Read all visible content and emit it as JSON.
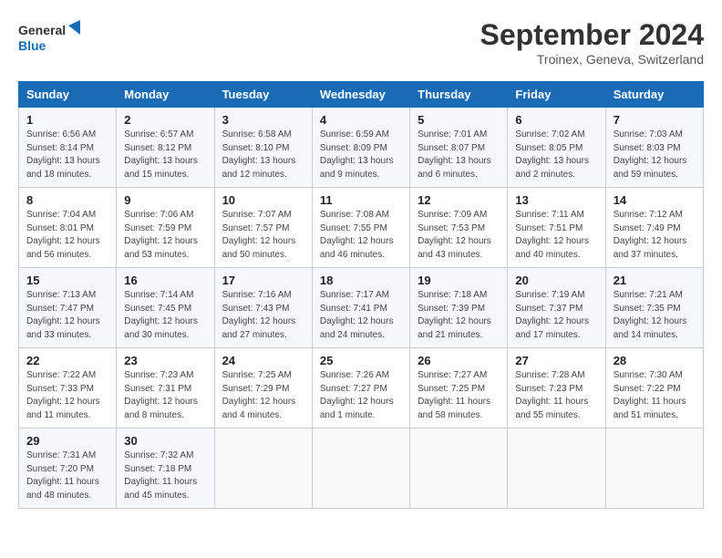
{
  "header": {
    "logo_line1": "General",
    "logo_line2": "Blue",
    "month_title": "September 2024",
    "location": "Troinex, Geneva, Switzerland"
  },
  "weekdays": [
    "Sunday",
    "Monday",
    "Tuesday",
    "Wednesday",
    "Thursday",
    "Friday",
    "Saturday"
  ],
  "weeks": [
    [
      {
        "day": "1",
        "info": "Sunrise: 6:56 AM\nSunset: 8:14 PM\nDaylight: 13 hours\nand 18 minutes."
      },
      {
        "day": "2",
        "info": "Sunrise: 6:57 AM\nSunset: 8:12 PM\nDaylight: 13 hours\nand 15 minutes."
      },
      {
        "day": "3",
        "info": "Sunrise: 6:58 AM\nSunset: 8:10 PM\nDaylight: 13 hours\nand 12 minutes."
      },
      {
        "day": "4",
        "info": "Sunrise: 6:59 AM\nSunset: 8:09 PM\nDaylight: 13 hours\nand 9 minutes."
      },
      {
        "day": "5",
        "info": "Sunrise: 7:01 AM\nSunset: 8:07 PM\nDaylight: 13 hours\nand 6 minutes."
      },
      {
        "day": "6",
        "info": "Sunrise: 7:02 AM\nSunset: 8:05 PM\nDaylight: 13 hours\nand 2 minutes."
      },
      {
        "day": "7",
        "info": "Sunrise: 7:03 AM\nSunset: 8:03 PM\nDaylight: 12 hours\nand 59 minutes."
      }
    ],
    [
      {
        "day": "8",
        "info": "Sunrise: 7:04 AM\nSunset: 8:01 PM\nDaylight: 12 hours\nand 56 minutes."
      },
      {
        "day": "9",
        "info": "Sunrise: 7:06 AM\nSunset: 7:59 PM\nDaylight: 12 hours\nand 53 minutes."
      },
      {
        "day": "10",
        "info": "Sunrise: 7:07 AM\nSunset: 7:57 PM\nDaylight: 12 hours\nand 50 minutes."
      },
      {
        "day": "11",
        "info": "Sunrise: 7:08 AM\nSunset: 7:55 PM\nDaylight: 12 hours\nand 46 minutes."
      },
      {
        "day": "12",
        "info": "Sunrise: 7:09 AM\nSunset: 7:53 PM\nDaylight: 12 hours\nand 43 minutes."
      },
      {
        "day": "13",
        "info": "Sunrise: 7:11 AM\nSunset: 7:51 PM\nDaylight: 12 hours\nand 40 minutes."
      },
      {
        "day": "14",
        "info": "Sunrise: 7:12 AM\nSunset: 7:49 PM\nDaylight: 12 hours\nand 37 minutes."
      }
    ],
    [
      {
        "day": "15",
        "info": "Sunrise: 7:13 AM\nSunset: 7:47 PM\nDaylight: 12 hours\nand 33 minutes."
      },
      {
        "day": "16",
        "info": "Sunrise: 7:14 AM\nSunset: 7:45 PM\nDaylight: 12 hours\nand 30 minutes."
      },
      {
        "day": "17",
        "info": "Sunrise: 7:16 AM\nSunset: 7:43 PM\nDaylight: 12 hours\nand 27 minutes."
      },
      {
        "day": "18",
        "info": "Sunrise: 7:17 AM\nSunset: 7:41 PM\nDaylight: 12 hours\nand 24 minutes."
      },
      {
        "day": "19",
        "info": "Sunrise: 7:18 AM\nSunset: 7:39 PM\nDaylight: 12 hours\nand 21 minutes."
      },
      {
        "day": "20",
        "info": "Sunrise: 7:19 AM\nSunset: 7:37 PM\nDaylight: 12 hours\nand 17 minutes."
      },
      {
        "day": "21",
        "info": "Sunrise: 7:21 AM\nSunset: 7:35 PM\nDaylight: 12 hours\nand 14 minutes."
      }
    ],
    [
      {
        "day": "22",
        "info": "Sunrise: 7:22 AM\nSunset: 7:33 PM\nDaylight: 12 hours\nand 11 minutes."
      },
      {
        "day": "23",
        "info": "Sunrise: 7:23 AM\nSunset: 7:31 PM\nDaylight: 12 hours\nand 8 minutes."
      },
      {
        "day": "24",
        "info": "Sunrise: 7:25 AM\nSunset: 7:29 PM\nDaylight: 12 hours\nand 4 minutes."
      },
      {
        "day": "25",
        "info": "Sunrise: 7:26 AM\nSunset: 7:27 PM\nDaylight: 12 hours\nand 1 minute."
      },
      {
        "day": "26",
        "info": "Sunrise: 7:27 AM\nSunset: 7:25 PM\nDaylight: 11 hours\nand 58 minutes."
      },
      {
        "day": "27",
        "info": "Sunrise: 7:28 AM\nSunset: 7:23 PM\nDaylight: 11 hours\nand 55 minutes."
      },
      {
        "day": "28",
        "info": "Sunrise: 7:30 AM\nSunset: 7:22 PM\nDaylight: 11 hours\nand 51 minutes."
      }
    ],
    [
      {
        "day": "29",
        "info": "Sunrise: 7:31 AM\nSunset: 7:20 PM\nDaylight: 11 hours\nand 48 minutes."
      },
      {
        "day": "30",
        "info": "Sunrise: 7:32 AM\nSunset: 7:18 PM\nDaylight: 11 hours\nand 45 minutes."
      },
      {
        "day": "",
        "info": ""
      },
      {
        "day": "",
        "info": ""
      },
      {
        "day": "",
        "info": ""
      },
      {
        "day": "",
        "info": ""
      },
      {
        "day": "",
        "info": ""
      }
    ]
  ]
}
